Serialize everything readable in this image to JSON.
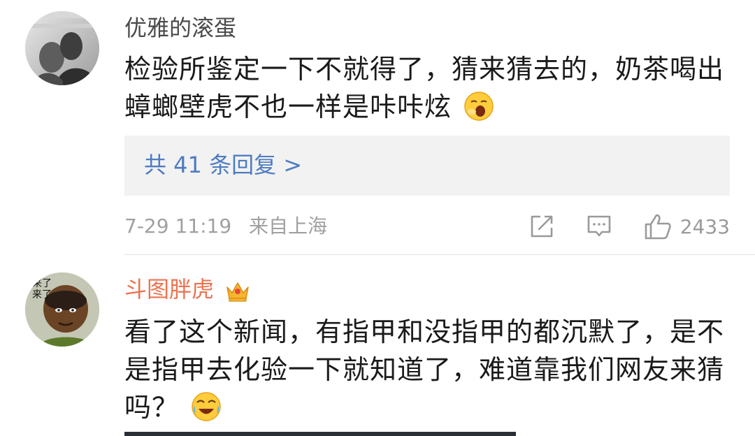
{
  "comments": [
    {
      "username": "优雅的滚蛋",
      "text": "检验所鉴定一下不就得了，猜来猜去的，奶茶喝出蟑螂壁虎不也一样是咔咔炫",
      "emoji": "yawn-emoji",
      "replies_label": "共 41 条回复 >",
      "time": "7-29 11:19",
      "location": "来自上海",
      "like_count": "2433"
    },
    {
      "username": "斗图胖虎",
      "badge": "crown-icon",
      "text": "看了这个新闻，有指甲和没指甲的都沉默了，是不是指甲去化验一下就知道了，难道靠我们网友来猜吗？",
      "emoji": "laugh-cry-emoji",
      "avatar_caption": "来了 来了"
    }
  ],
  "colors": {
    "username_default": "#4a4a4a",
    "username_vip": "#eb7350",
    "link": "#4d7cc2",
    "meta": "#a0a0a0",
    "reply_bg": "#f2f2f2"
  }
}
